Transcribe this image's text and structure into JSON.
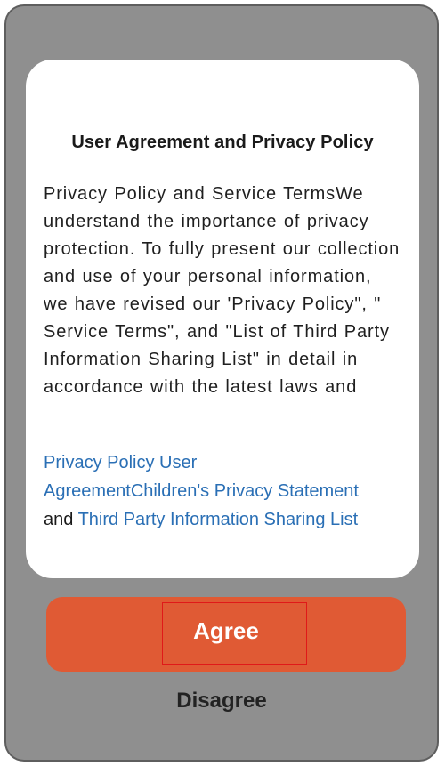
{
  "dialog": {
    "title": "User Agreement and Privacy Policy",
    "body_lines": [
      "Privacy Policy and Service TermsWe",
      "understand the importance of privacy",
      "protection. To fully present our collection",
      "and use of your personal information,",
      "we have revised our 'Privacy Policy\", \"",
      "Service Terms\", and \"List of Third Party",
      "Information Sharing List\" in detail in",
      "accordance with the latest laws and"
    ],
    "links": {
      "privacy_policy": "Privacy Policy",
      "user_agreement_part1": "User",
      "user_agreement_part2": "Agreement",
      "children_privacy": "Children's Privacy Statement",
      "and_text": "and",
      "third_party_list": "Third Party Information Sharing List"
    }
  },
  "buttons": {
    "agree_label": "Agree",
    "disagree_label": "Disagree"
  },
  "colors": {
    "backdrop": "#8f8f8f",
    "agree_button": "#e05a34",
    "link": "#2a6fb5",
    "focus_outline": "#e01919"
  }
}
